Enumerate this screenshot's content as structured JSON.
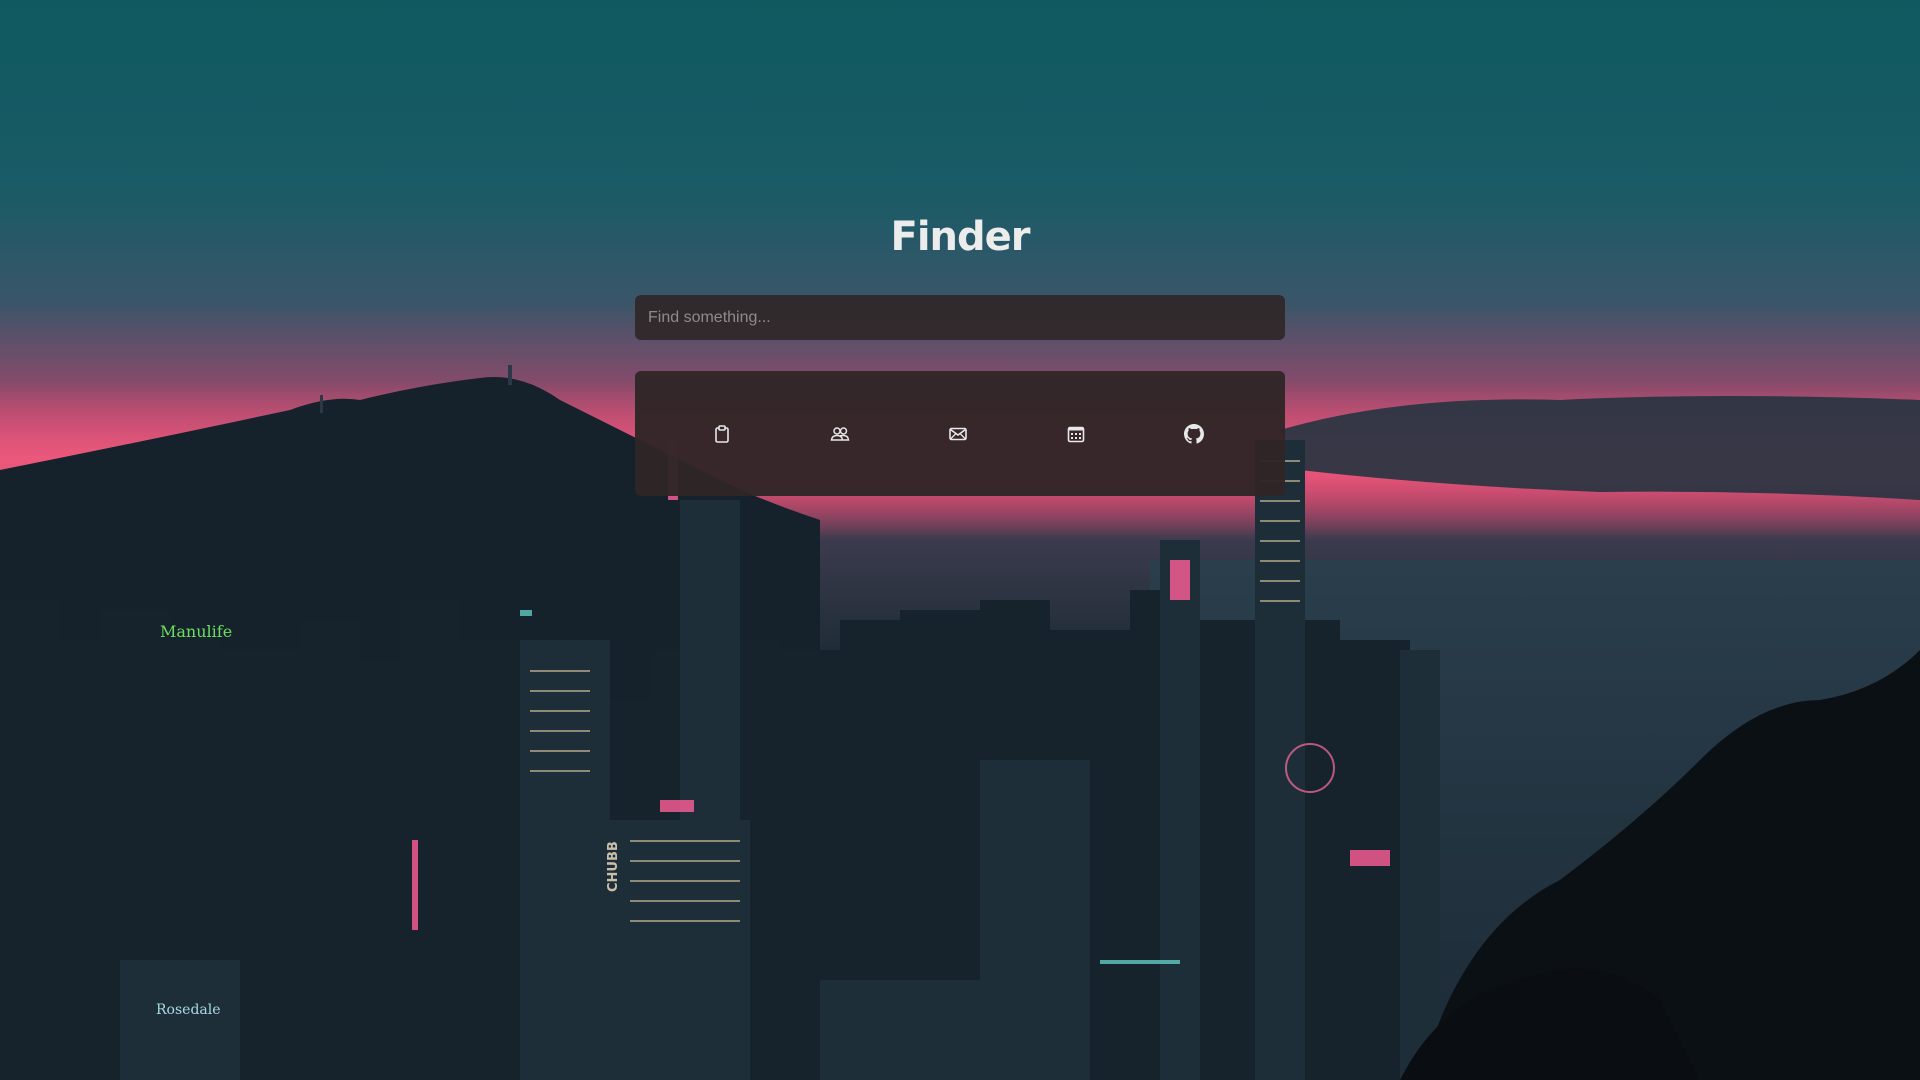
{
  "app": {
    "title": "Finder"
  },
  "search": {
    "placeholder": "Find something..."
  },
  "shortcuts": [
    {
      "icon": "clipboard-icon"
    },
    {
      "icon": "users-icon"
    },
    {
      "icon": "envelope-icon"
    },
    {
      "icon": "calendar-icon"
    },
    {
      "icon": "github-icon"
    }
  ],
  "background_signs": {
    "sign_1": "Manulife",
    "sign_2": "CHUBB",
    "sign_3": "Rosedale"
  },
  "colors": {
    "panel": "#30282a",
    "title": "#ececec",
    "icon": "#e8e8e8",
    "sky_top": "#0f5a60",
    "sky_glow": "#e04a73"
  }
}
